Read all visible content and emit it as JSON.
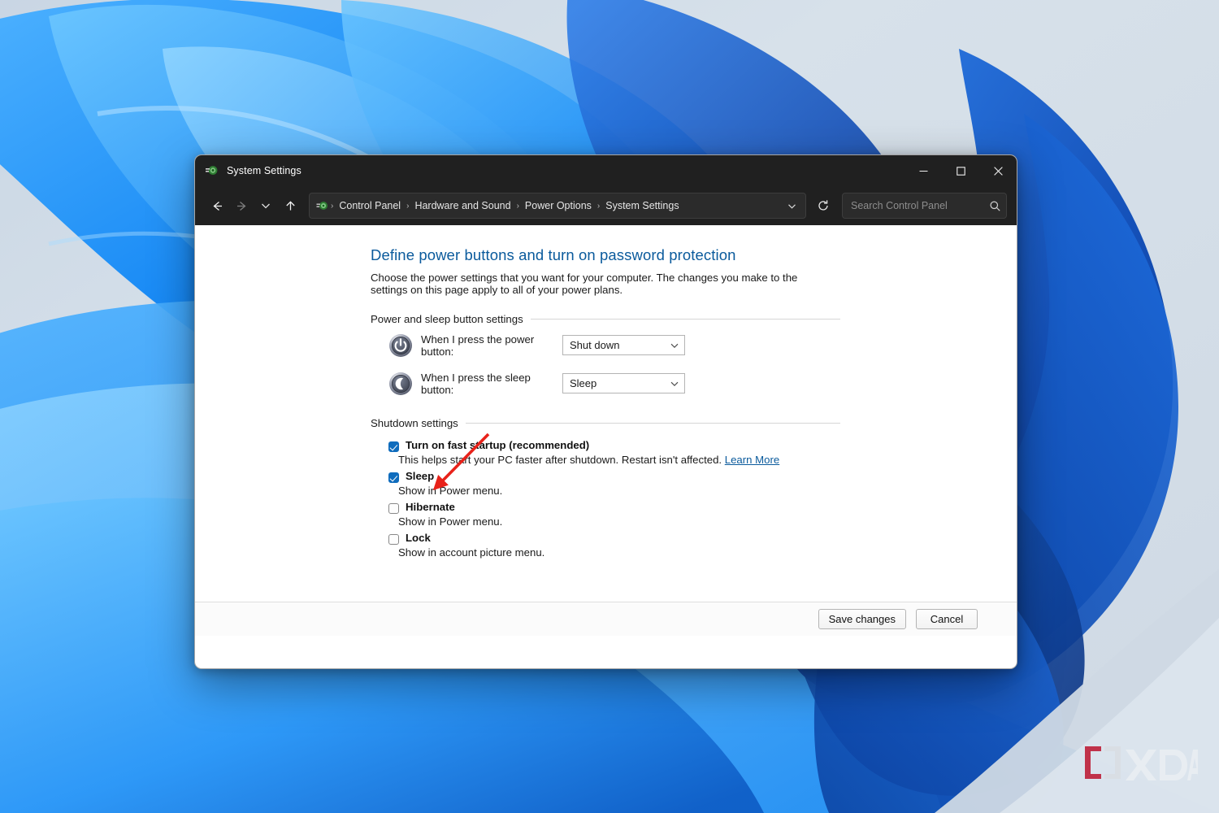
{
  "window": {
    "title": "System Settings",
    "title_icon": "system-settings-icon",
    "controls": {
      "minimize": "–",
      "maximize": "☐",
      "close": "✕"
    }
  },
  "toolbar": {
    "back_icon": "back-arrow-icon",
    "forward_icon": "forward-arrow-icon",
    "recent_icon": "chevron-down-icon",
    "up_icon": "up-arrow-icon",
    "refresh_icon": "refresh-icon",
    "address_chevron_icon": "chevron-down-icon",
    "breadcrumb_icon": "control-panel-icon",
    "breadcrumbs": [
      "Control Panel",
      "Hardware and Sound",
      "Power Options",
      "System Settings"
    ],
    "separator": "›",
    "search": {
      "placeholder": "Search Control Panel",
      "value": "",
      "icon": "search-icon"
    }
  },
  "main": {
    "title": "Define power buttons and turn on password protection",
    "description": "Choose the power settings that you want for your computer. The changes you make to the settings on this page apply to all of your power plans.",
    "power_group": {
      "label": "Power and sleep button settings",
      "rows": [
        {
          "icon": "power-button-icon",
          "label": "When I press the power button:",
          "value": "Shut down"
        },
        {
          "icon": "sleep-button-icon",
          "label": "When I press the sleep button:",
          "value": "Sleep"
        }
      ]
    },
    "shutdown_group": {
      "label": "Shutdown settings",
      "items": [
        {
          "label": "Turn on fast startup (recommended)",
          "checked": true,
          "description": "This helps start your PC faster after shutdown. Restart isn't affected.",
          "link": "Learn More"
        },
        {
          "label": "Sleep",
          "checked": true,
          "description": "Show in Power menu.",
          "link": ""
        },
        {
          "label": "Hibernate",
          "checked": false,
          "description": "Show in Power menu.",
          "link": ""
        },
        {
          "label": "Lock",
          "checked": false,
          "description": "Show in account picture menu.",
          "link": ""
        }
      ]
    }
  },
  "footer": {
    "save_label": "Save changes",
    "cancel_label": "Cancel"
  },
  "annotation": {
    "type": "arrow",
    "color": "#e8221a",
    "points_to": "hibernate-checkbox"
  },
  "watermark": {
    "text": "XDA",
    "bracket_color": "#c0324a",
    "text_color": "#e8edf2"
  },
  "colors": {
    "accent": "#0f6cbd",
    "heading": "#0a5a9c",
    "titlebar": "#202020",
    "window_bg": "#ffffff"
  }
}
